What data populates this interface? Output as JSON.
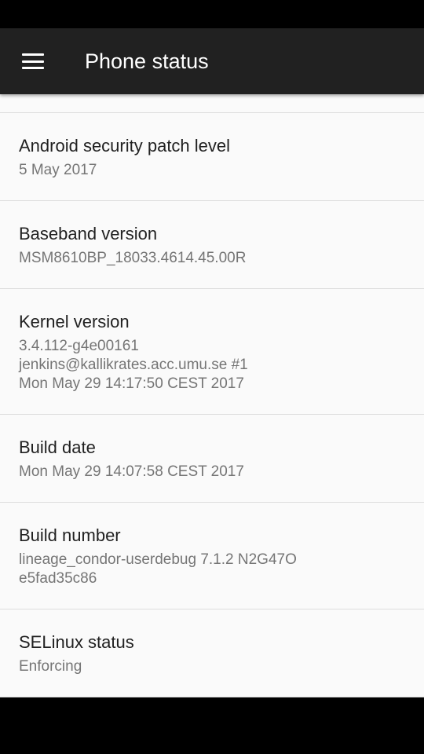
{
  "toolbar": {
    "title": "Phone status",
    "menu_icon": "hamburger-menu-icon"
  },
  "items": [
    {
      "title": "Android security patch level",
      "summary": "5 May 2017"
    },
    {
      "title": "Baseband version",
      "summary": "MSM8610BP_18033.4614.45.00R"
    },
    {
      "title": "Kernel version",
      "summary": "3.4.112-g4e00161\njenkins@kallikrates.acc.umu.se #1\nMon May 29 14:17:50 CEST 2017"
    },
    {
      "title": "Build date",
      "summary": "Mon May 29 14:07:58 CEST 2017"
    },
    {
      "title": "Build number",
      "summary": "lineage_condor-userdebug 7.1.2 N2G47O\ne5fad35c86"
    },
    {
      "title": "SELinux status",
      "summary": "Enforcing"
    }
  ],
  "colors": {
    "toolbar": "#212121",
    "background": "#fafafa",
    "title_text": "#212121",
    "summary_text": "#757575",
    "divider": "#dcdcdc"
  }
}
